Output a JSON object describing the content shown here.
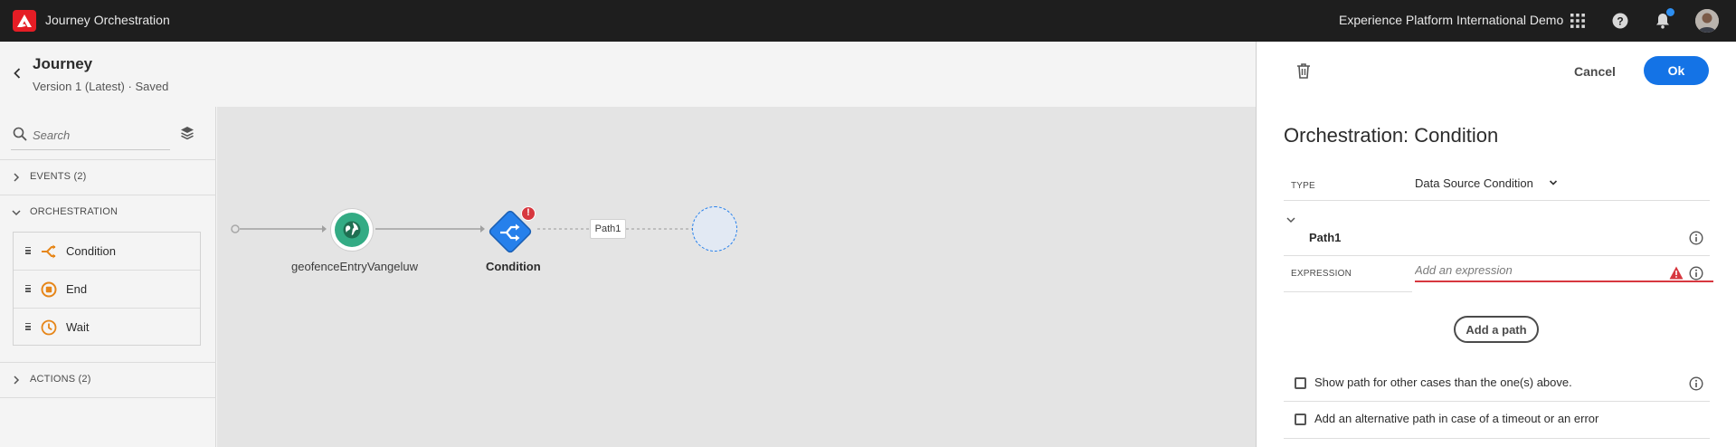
{
  "topbar": {
    "app_title": "Journey Orchestration",
    "org_name": "Experience Platform International Demo",
    "icons": [
      "adobe-logo",
      "apps-grid-icon",
      "help-icon",
      "bell-icon",
      "avatar"
    ]
  },
  "journey": {
    "title": "Journey",
    "version": "Version 1 (Latest) · Saved"
  },
  "sidebar": {
    "search_placeholder": "Search",
    "sections": {
      "events": "EVENTS (2)",
      "orchestration": "ORCHESTRATION",
      "actions": "ACTIONS (2)"
    },
    "orchestration_items": [
      {
        "label": "Condition",
        "icon": "condition-icon"
      },
      {
        "label": "End",
        "icon": "end-icon"
      },
      {
        "label": "Wait",
        "icon": "clock-icon"
      }
    ]
  },
  "canvas": {
    "nodes": {
      "event_label": "geofenceEntryVangeluw",
      "condition_label": "Condition",
      "path_tag": "Path1"
    }
  },
  "panel": {
    "cancel_label": "Cancel",
    "ok_label": "Ok",
    "title": "Orchestration: Condition",
    "type_label": "TYPE",
    "type_value": "Data Source Condition",
    "path_name": "Path1",
    "expression_label": "EXPRESSION",
    "expression_placeholder": "Add an expression",
    "add_path_label": "Add a path",
    "checkbox_other_cases": "Show path for other cases than the one(s) above.",
    "checkbox_timeout": "Add an alternative path in case of a timeout or an error"
  },
  "colors": {
    "accent_blue": "#1473e6",
    "error_red": "#d7373f",
    "event_green": "#33ab84",
    "orchestration_orange": "#e68619",
    "topbar_bg": "#1e1e1e"
  }
}
